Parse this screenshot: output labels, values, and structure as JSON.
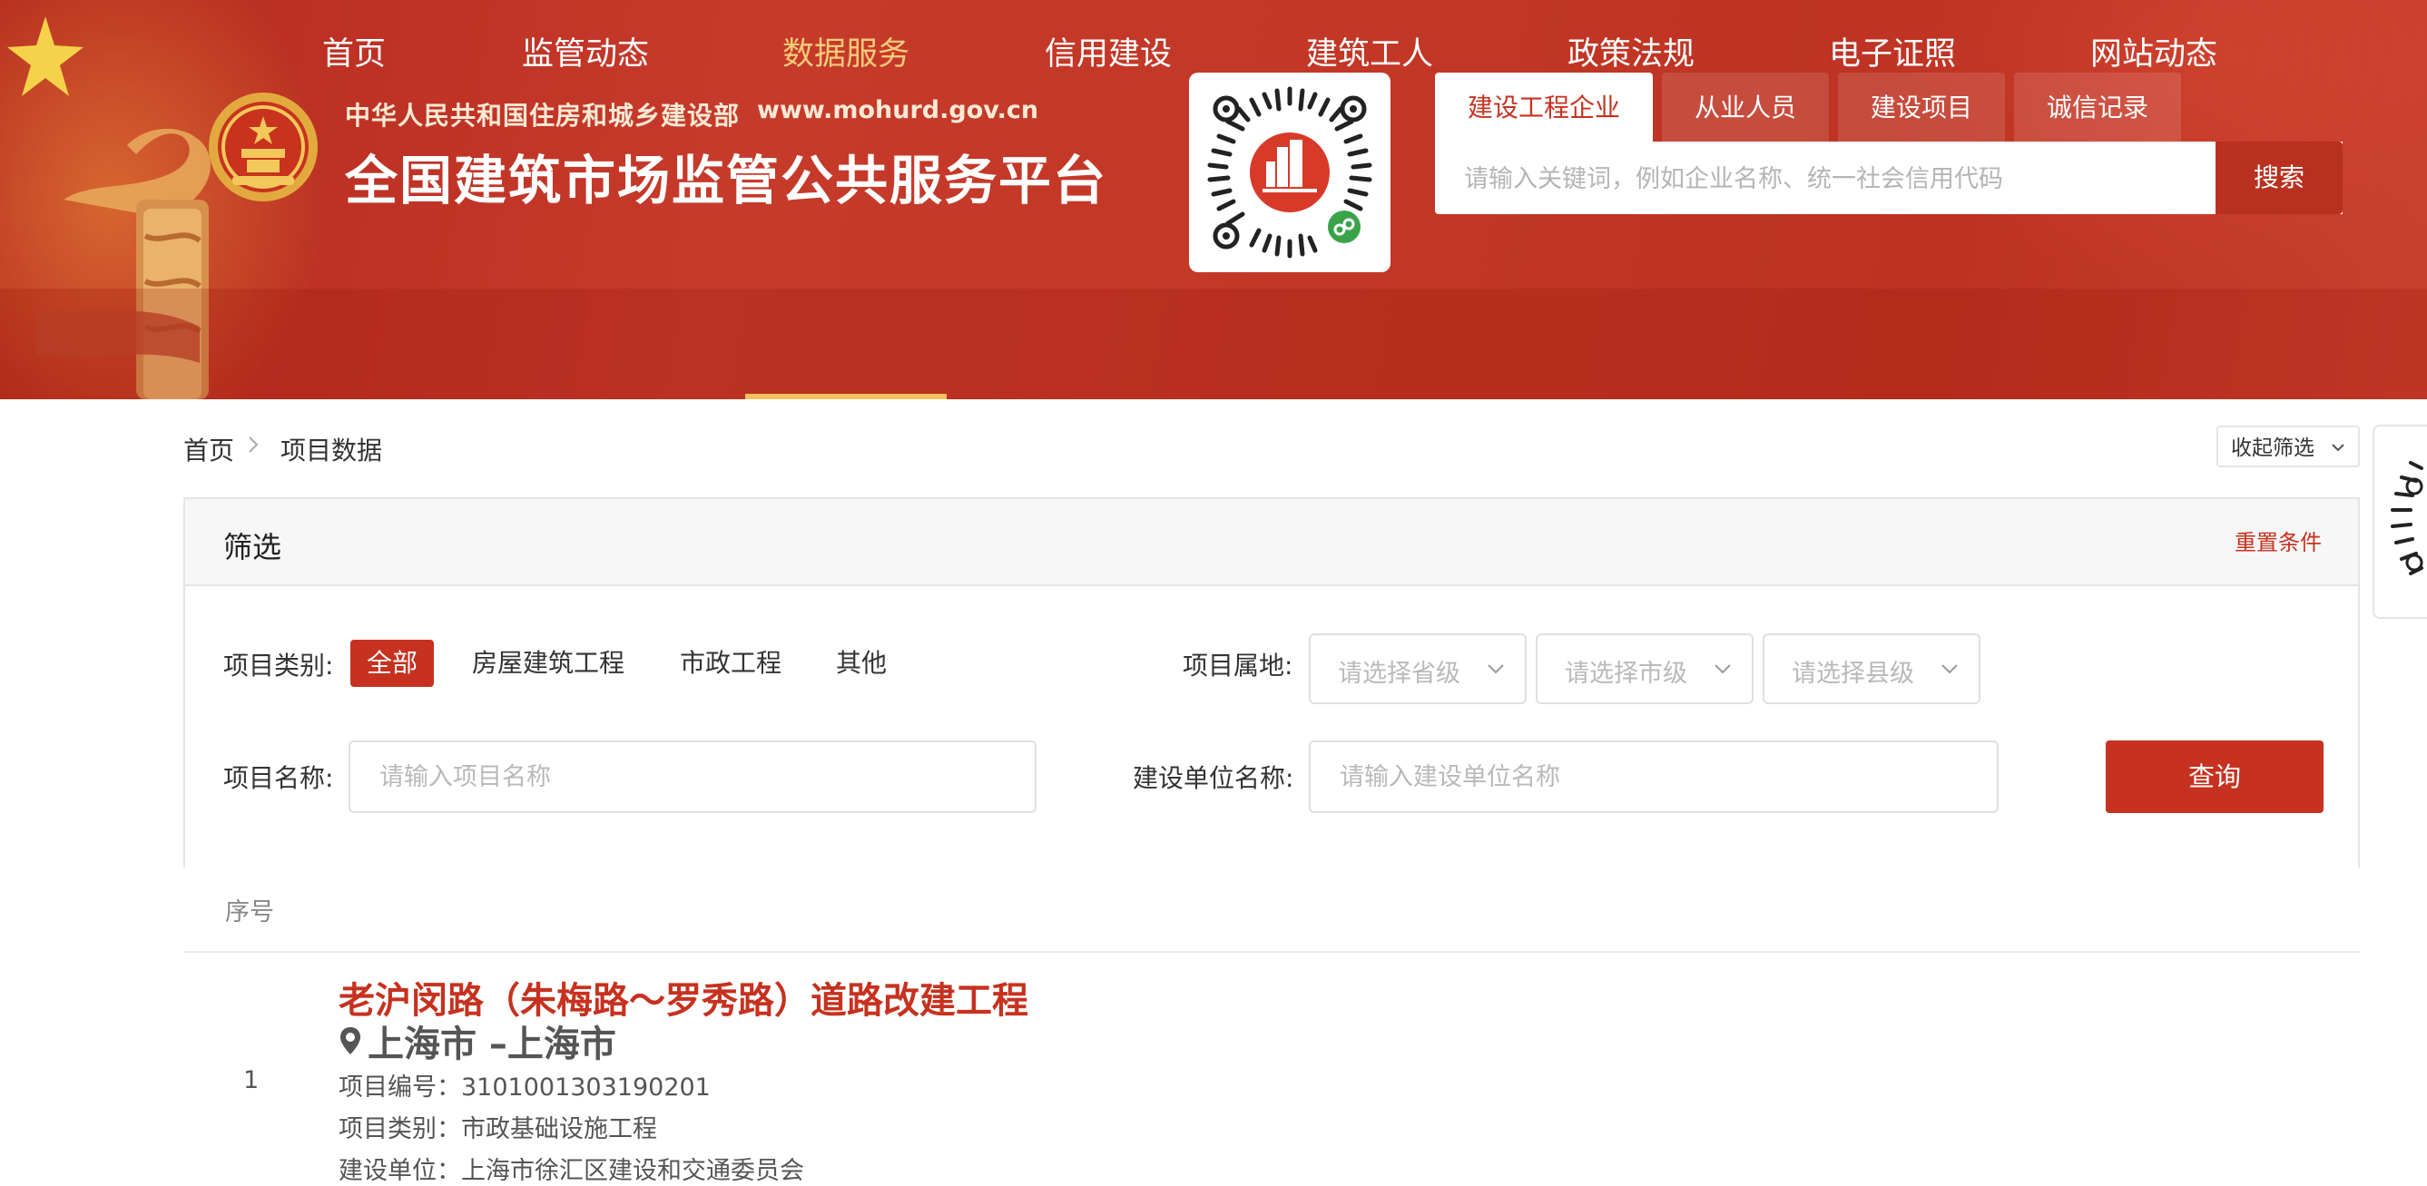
{
  "header": {
    "org_name": "中华人民共和国住房和城乡建设部",
    "site_url": "www.mohurd.gov.cn",
    "site_title": "全国建筑市场监管公共服务平台",
    "search_tabs": [
      {
        "label": "建设工程企业",
        "active": true
      },
      {
        "label": "从业人员",
        "active": false
      },
      {
        "label": "建设项目",
        "active": false
      },
      {
        "label": "诚信记录",
        "active": false
      }
    ],
    "search_placeholder": "请输入关键词，例如企业名称、统一社会信用代码",
    "search_button": "搜索"
  },
  "nav": {
    "items": [
      {
        "label": "首页"
      },
      {
        "label": "监管动态"
      },
      {
        "label": "数据服务",
        "active": true
      },
      {
        "label": "信用建设"
      },
      {
        "label": "建筑工人"
      },
      {
        "label": "政策法规"
      },
      {
        "label": "电子证照"
      },
      {
        "label": "网站动态"
      }
    ]
  },
  "breadcrumb": {
    "home": "首页",
    "current": "项目数据"
  },
  "collapse_filter": "收起筛选",
  "filter": {
    "title": "筛选",
    "reset": "重置条件",
    "type_label": "项目类别:",
    "type_options": [
      "全部",
      "房屋建筑工程",
      "市政工程",
      "其他"
    ],
    "location_label": "项目属地:",
    "province_placeholder": "请选择省级",
    "city_placeholder": "请选择市级",
    "county_placeholder": "请选择县级",
    "name_label": "项目名称:",
    "name_placeholder": "请输入项目名称",
    "builder_label": "建设单位名称:",
    "builder_placeholder": "请输入建设单位名称",
    "query_button": "查询"
  },
  "results": {
    "col_index": "序号",
    "rows": [
      {
        "index": "1",
        "title": "老沪闵路（朱梅路～罗秀路）道路改建工程",
        "location": "上海市 –上海市",
        "code": "项目编号：3101001303190201",
        "category": "项目类别：市政基础设施工程",
        "builder": "建设单位：上海市徐汇区建设和交通委员会"
      }
    ]
  },
  "colors": {
    "brand_red": "#c6321f",
    "nav_active": "#f8cb7a"
  }
}
